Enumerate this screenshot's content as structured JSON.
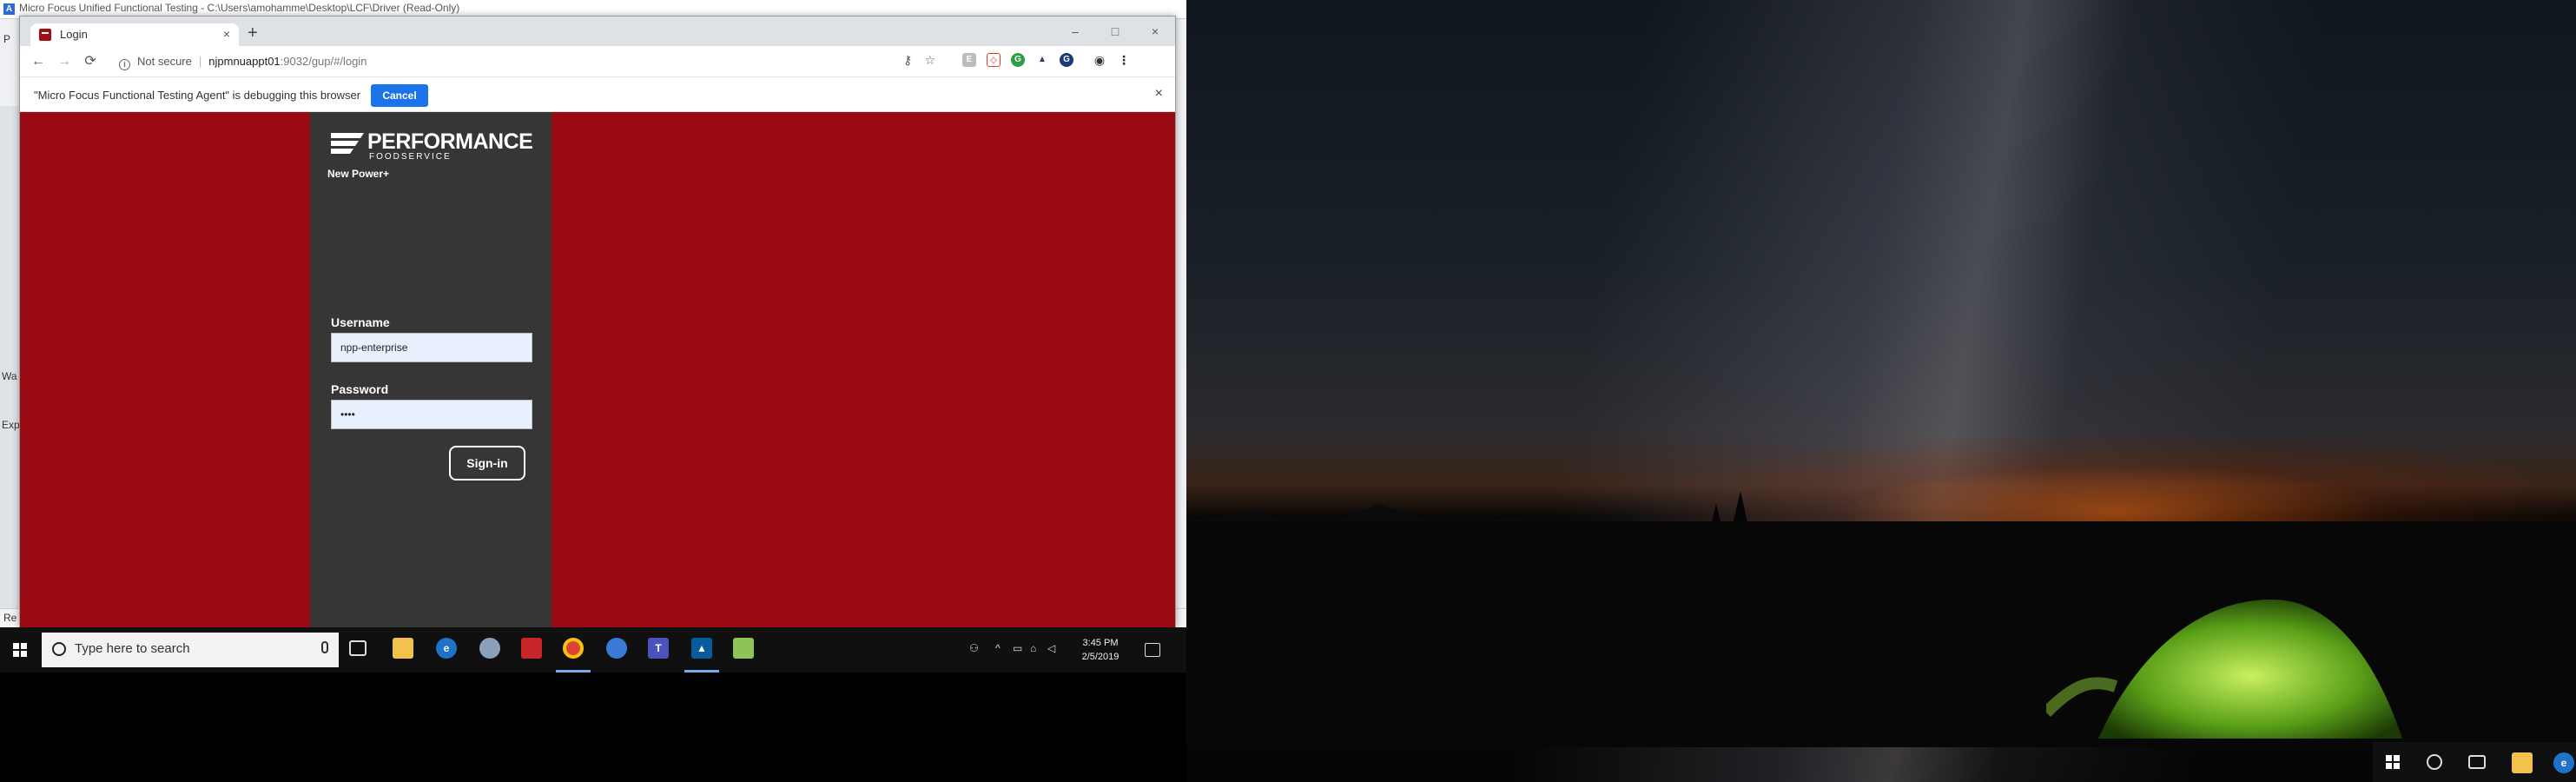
{
  "uft": {
    "title": "Micro Focus Unified Functional Testing - C:\\Users\\amohamme\\Desktop\\LCF\\Driver (Read-Only)",
    "logo": "A",
    "side_label_p": "P",
    "side_label_wa": "Wa",
    "side_label_exp": "Exp",
    "status": "Re"
  },
  "browser": {
    "tab_title": "Login",
    "tab_close": "×",
    "new_tab": "+",
    "minimize": "–",
    "maximize": "□",
    "close": "×",
    "back": "←",
    "forward": "→",
    "reload": "⟳",
    "not_secure": "Not secure",
    "url_host": "njpmnuappt01",
    "url_path": ":9032/gup/#/login",
    "debug_message": "\"Micro Focus Functional Testing Agent\" is debugging this browser",
    "cancel_label": "Cancel",
    "debug_close": "×"
  },
  "page": {
    "logo_text": "PERFORMANCE",
    "logo_sub": "FOODSERVICE",
    "app_name": "New Power+",
    "username_label": "Username",
    "username_value": "npp-enterprise",
    "password_label": "Password",
    "password_value": "••••",
    "signin_label": "Sign-in",
    "bg_color": "#9a0a12",
    "panel_color": "#363636"
  },
  "taskbar": {
    "search_placeholder": "Type here to search",
    "clock_time": "3:45 PM",
    "clock_date": "2/5/2019"
  },
  "taskbar_icons": [
    "task-view-icon",
    "file-explorer-icon",
    "edge-icon",
    "paint-icon",
    "office-icon",
    "chrome-icon",
    "chat-icon",
    "teams-icon",
    "uft-icon",
    "notepad-icon"
  ]
}
